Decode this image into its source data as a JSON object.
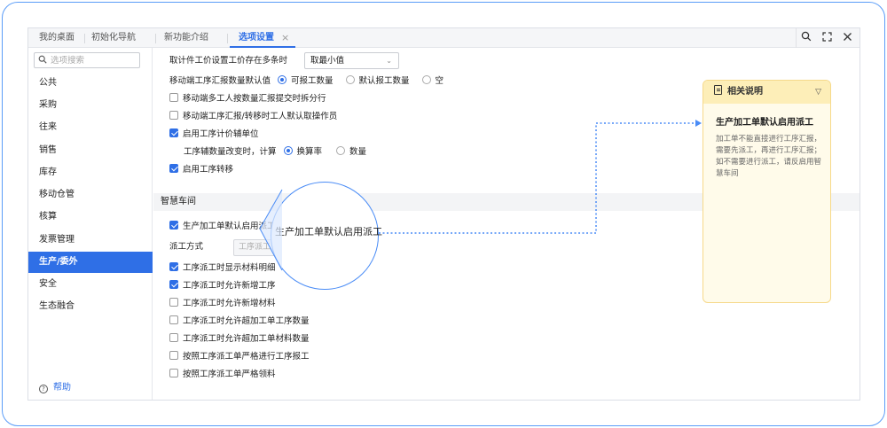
{
  "tabs": [
    {
      "label": "我的桌面"
    },
    {
      "label": "初始化导航"
    },
    {
      "label": "新功能介绍"
    },
    {
      "label": "选项设置",
      "active": true
    }
  ],
  "window_controls": [
    "search-icon",
    "expand-icon",
    "close-icon"
  ],
  "sidebar": {
    "search_placeholder": "选项搜索",
    "items": [
      {
        "label": "公共"
      },
      {
        "label": "采购"
      },
      {
        "label": "往来"
      },
      {
        "label": "销售"
      },
      {
        "label": "库存"
      },
      {
        "label": "移动仓管"
      },
      {
        "label": "核算"
      },
      {
        "label": "发票管理"
      },
      {
        "label": "生产/委外",
        "active": true
      },
      {
        "label": "安全"
      },
      {
        "label": "生态融合"
      }
    ],
    "help_label": "帮助"
  },
  "settings": {
    "price_rule_label": "取计件工价设置工价存在多条时",
    "price_rule_value": "取最小值",
    "mobile_default_label": "移动端工序汇报数量默认值",
    "mobile_default_options": [
      {
        "label": "可报工数量",
        "checked": true
      },
      {
        "label": "默认报工数量",
        "checked": false
      },
      {
        "label": "空",
        "checked": false
      }
    ],
    "split_submit": {
      "label": "移动端多工人按数量汇报提交时拆分行",
      "checked": false
    },
    "cancel_operator": {
      "label": "移动端工序汇报/转移时工人默认取操作员",
      "checked": false
    },
    "piece_aux_unit": {
      "label": "启用工序计价辅单位",
      "checked": true
    },
    "aux_change_label": "工序辅数量改变时，计算",
    "aux_change_options": [
      {
        "label": "换算率",
        "checked": true
      },
      {
        "label": "数量",
        "checked": false
      }
    ],
    "process_transfer": {
      "label": "启用工序转移",
      "checked": true
    }
  },
  "smart_workshop": {
    "section_title": "智慧车间",
    "default_dispatch": {
      "label": "生产加工单默认启用派工",
      "checked": true
    },
    "dispatch_method_label": "派工方式",
    "dispatch_method_value": "工序派工",
    "options": [
      {
        "label": "工序派工时显示材料明细",
        "checked": true
      },
      {
        "label": "工序派工时允许新增工序",
        "checked": true
      },
      {
        "label": "工序派工时允许新增材料",
        "checked": false
      },
      {
        "label": "工序派工时允许超加工单工序数量",
        "checked": false
      },
      {
        "label": "工序派工时允许超加工单材料数量",
        "checked": false
      },
      {
        "label": "按照工序派工单严格进行工序报工",
        "checked": false
      },
      {
        "label": "按照工序派工单严格领料",
        "checked": false
      }
    ]
  },
  "magnifier": {
    "text": "生产加工单默认启用派工"
  },
  "help_panel": {
    "header": "相关说明",
    "title": "生产加工单默认启用派工",
    "body": "加工单不能直接进行工序汇报，需要先派工，再进行工序汇报；如不需要进行派工，请反启用智慧车间"
  },
  "colors": {
    "accent": "#2f6fe6",
    "panel_bg": "#fffbea",
    "panel_header": "#fdeeb8",
    "frame": "#5a9cf8"
  }
}
